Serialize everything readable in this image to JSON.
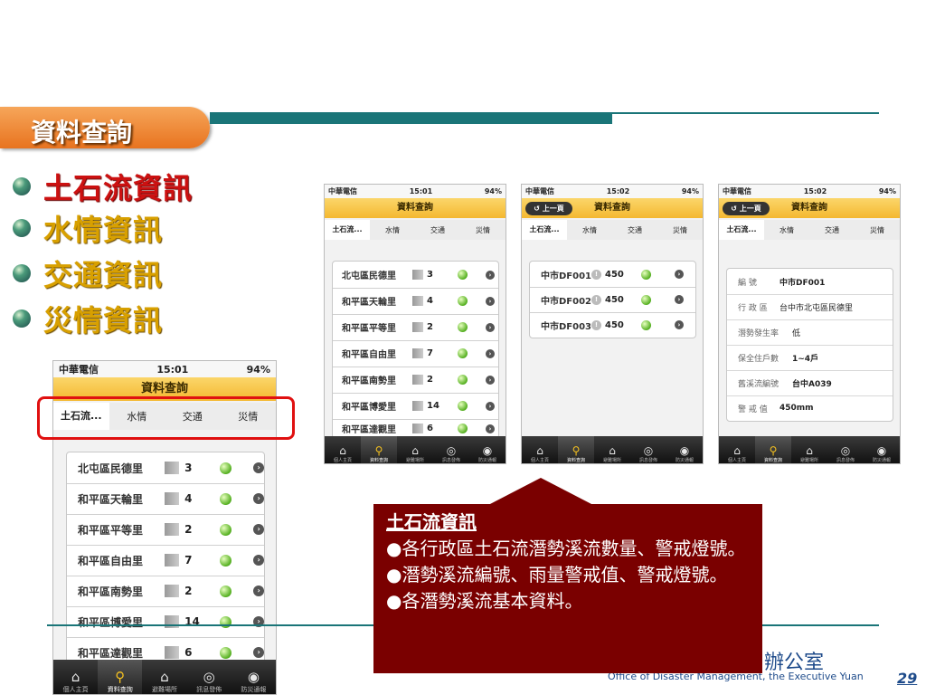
{
  "slide": {
    "title": "資料查詢",
    "bullets": [
      "土石流資訊",
      "水情資訊",
      "交通資訊",
      "災情資訊"
    ],
    "page_number": "29",
    "footer_org": "辦公室",
    "footer_en": "Office of Disaster Management, the Executive Yuan"
  },
  "phone": {
    "carrier": "中華電信",
    "battery": "94%",
    "time1": "15:01",
    "time2": "15:02",
    "nav_title": "資料查詢",
    "back_label": "上一頁",
    "tabs": [
      "土石流...",
      "水情",
      "交通",
      "災情"
    ],
    "toolbar": [
      "個人主頁",
      "資料查詢",
      "避難場所",
      "訊息發佈",
      "防災通報"
    ],
    "villages": [
      {
        "name": "北屯區民德里",
        "count": "3"
      },
      {
        "name": "和平區天輪里",
        "count": "4"
      },
      {
        "name": "和平區平等里",
        "count": "2"
      },
      {
        "name": "和平區自由里",
        "count": "7"
      },
      {
        "name": "和平區南勢里",
        "count": "2"
      },
      {
        "name": "和平區博愛里",
        "count": "14"
      },
      {
        "name": "和平區達觀里",
        "count": "6"
      }
    ],
    "streams": [
      {
        "id": "中市DF001",
        "value": "450"
      },
      {
        "id": "中市DF002",
        "value": "450"
      },
      {
        "id": "中市DF003",
        "value": "450"
      }
    ],
    "details": [
      {
        "k": "編 號",
        "v": "中市DF001"
      },
      {
        "k": "行 政 區",
        "v": "台中市北屯區民德里"
      },
      {
        "k": "潛勢發生率",
        "v": "低"
      },
      {
        "k": "保全住戶數",
        "v": "1~4戶"
      },
      {
        "k": "舊溪流編號",
        "v": "台中A039"
      },
      {
        "k": "警 戒 值",
        "v": "450mm"
      }
    ]
  },
  "callout": {
    "heading": "土石流資訊",
    "lines": [
      "●各行政區土石流潛勢溪流數量、警戒燈號。",
      "●潛勢溪流編號、雨量警戒值、警戒燈號。",
      "●各潛勢溪流基本資料。"
    ]
  }
}
